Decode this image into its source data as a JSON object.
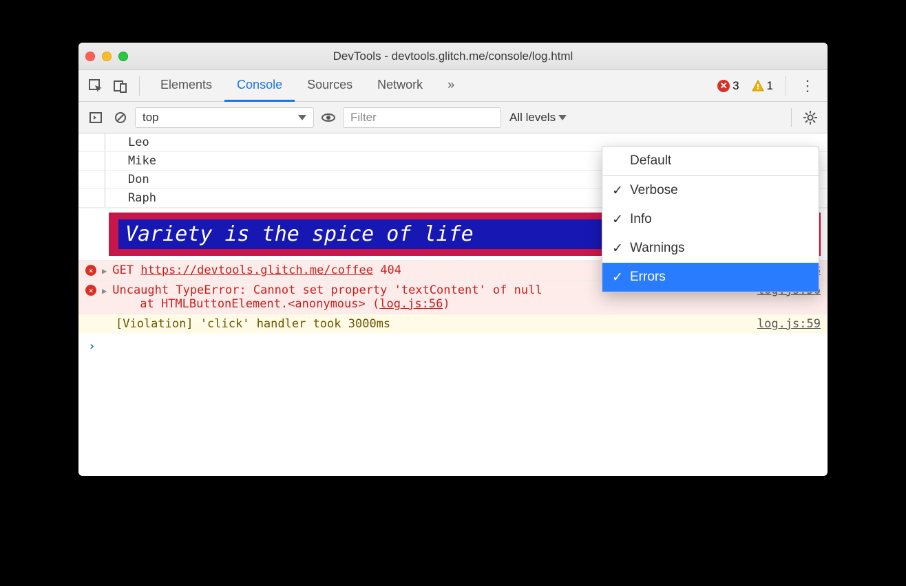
{
  "window": {
    "title": "DevTools - devtools.glitch.me/console/log.html"
  },
  "tabs": {
    "items": [
      "Elements",
      "Console",
      "Sources",
      "Network"
    ],
    "active": "Console",
    "overflow_glyph": "»"
  },
  "counts": {
    "errors": "3",
    "warnings": "1"
  },
  "filterbar": {
    "context": "top",
    "filter_placeholder": "Filter",
    "levels_label": "All levels"
  },
  "dropdown": {
    "default_label": "Default",
    "items": [
      {
        "label": "Verbose",
        "checked": true,
        "selected": false
      },
      {
        "label": "Info",
        "checked": true,
        "selected": false
      },
      {
        "label": "Warnings",
        "checked": true,
        "selected": false
      },
      {
        "label": "Errors",
        "checked": true,
        "selected": true
      }
    ]
  },
  "logs": {
    "group_items": [
      "Leo",
      "Mike",
      "Don",
      "Raph"
    ],
    "styled_text": "Variety is the spice of life",
    "error_get": {
      "method": "GET",
      "url": "https://devtools.glitch.me/coffee",
      "status": "404",
      "source": "log.js:68"
    },
    "error_type": {
      "line1": "Uncaught TypeError: Cannot set property 'textContent' of null",
      "stack_prefix": "at HTMLButtonElement.<anonymous> (",
      "stack_link": "log.js:56",
      "stack_suffix": ")",
      "source": "log.js:56"
    },
    "violation": {
      "text": "[Violation] 'click' handler took 3000ms",
      "source": "log.js:59"
    }
  }
}
